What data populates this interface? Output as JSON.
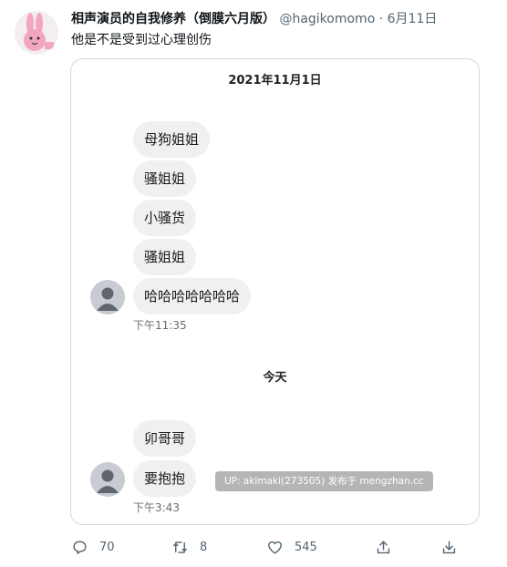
{
  "tweet": {
    "display_name": "相声演员的自我修养（倒膜六月版）",
    "handle": "@hagikomomo",
    "separator": "·",
    "date": "6月11日",
    "text": "他是不是受到过心理创伤"
  },
  "chat": {
    "date_header": "2021年11月1日",
    "group1_messages": [
      "母狗姐姐",
      "骚姐姐",
      "小骚货",
      "骚姐姐",
      "哈哈哈哈哈哈哈"
    ],
    "group1_time": "下午11:35",
    "day_divider": "今天",
    "group2_messages": [
      "卯哥哥",
      "要抱抱"
    ],
    "group2_time": "下午3:43",
    "watermark": "UP: akimaki(273505) 发布于 mengzhan.cc"
  },
  "actions": {
    "reply_count": "70",
    "retweet_count": "8",
    "like_count": "545"
  }
}
